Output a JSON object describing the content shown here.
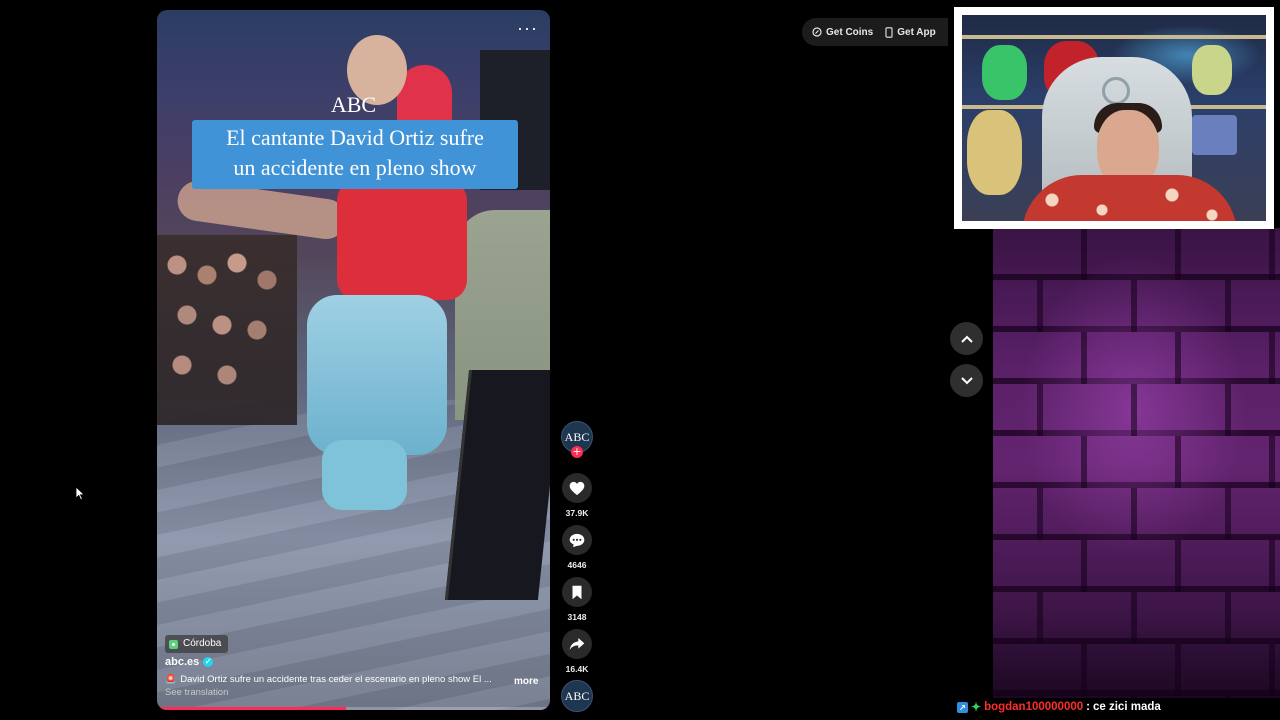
{
  "video": {
    "menu_label": "···",
    "overlay_logo": "ABC",
    "headline_line1": "El cantante David Ortiz sufre",
    "headline_line2": "un accidente en pleno show",
    "location": "Córdoba",
    "author": "abc.es",
    "description": "David Ortiz sufre un accidente tras ceder el escenario en pleno show  El ...",
    "more_label": "more",
    "translate_label": "See translation",
    "progress": 0.48
  },
  "actions": {
    "avatar_text": "ABC",
    "follow_label": "+",
    "likes": "37.9K",
    "comments": "4646",
    "saves": "3148",
    "shares": "16.4K"
  },
  "top_bar": {
    "coins_label": "Get Coins",
    "app_label": "Get App"
  },
  "chat": {
    "username": "bogdan100000000",
    "separator": ":",
    "message": "ce zici mada"
  },
  "colors": {
    "accent": "#fe2c55",
    "headline_bg": "#3f93d6",
    "chat_user": "#ff2d2d"
  }
}
